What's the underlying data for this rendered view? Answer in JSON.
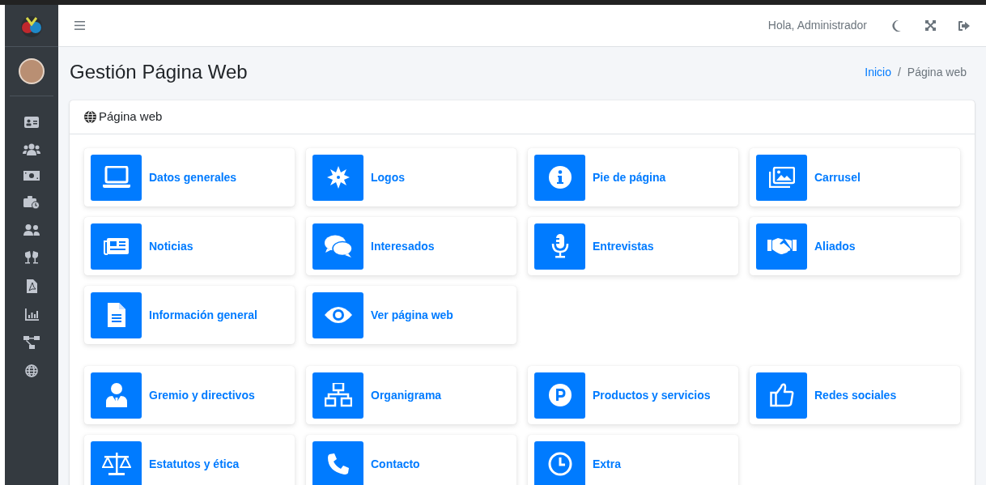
{
  "topbar": {
    "greeting": "Hola, Administrador"
  },
  "page": {
    "title": "Gestión Página Web"
  },
  "breadcrumb": [
    {
      "kind": "item",
      "label": "Inicio",
      "link": true
    },
    {
      "kind": "separator",
      "label": "/"
    },
    {
      "kind": "item",
      "label": "Página web",
      "link": false
    }
  ],
  "card": {
    "title": "Página web"
  },
  "groups": [
    [
      {
        "label": "Datos generales"
      },
      {
        "label": "Logos"
      },
      {
        "label": "Pie de página"
      },
      {
        "label": "Carrusel"
      },
      {
        "label": "Noticias"
      },
      {
        "label": "Interesados"
      },
      {
        "label": "Entrevistas"
      },
      {
        "label": "Aliados"
      },
      {
        "label": "Información general"
      },
      {
        "label": "Ver página web"
      }
    ],
    [
      {
        "label": "Gremio y directivos"
      },
      {
        "label": "Organigrama"
      },
      {
        "label": "Productos y servicios"
      },
      {
        "label": "Redes sociales"
      },
      {
        "label": "Estatutos y ética"
      },
      {
        "label": "Contacto"
      },
      {
        "label": "Extra"
      }
    ]
  ]
}
